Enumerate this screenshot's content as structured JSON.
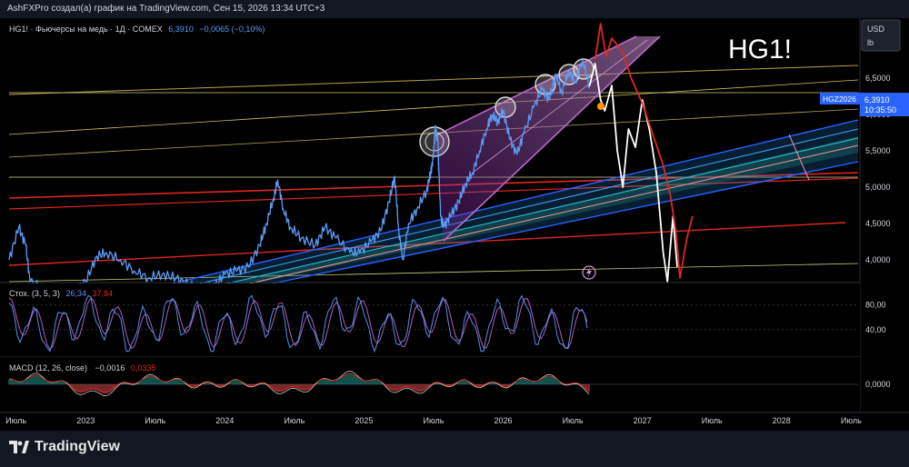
{
  "header": {
    "attribution": "AshFXPro создал(а) график на TradingView.com, Сен 15, 2026 13:34 UTC+3"
  },
  "legend": {
    "symbol": "HG1! · Фьючерсы на медь · 1Д · COMEX",
    "last": "6,3910",
    "change": "−0,0065 (−0,10%)"
  },
  "watermark": "HG1!",
  "currency": {
    "unit": "USD",
    "sub": "lb"
  },
  "price_tag": {
    "contract": "HGZ2026",
    "price": "6,3910",
    "countdown": "10:35:50"
  },
  "stoch": {
    "label": "Стох. (3, 5, 3)",
    "k": "26,34",
    "d": "37,84",
    "ticks": [
      "80,00",
      "40,00"
    ],
    "tick_values": [
      80,
      40
    ],
    "range": [
      0,
      100
    ]
  },
  "macd": {
    "label": "MACD (12, 26, close)",
    "hist": "−0,0016",
    "signal": "0,0335",
    "ticks": [
      "0,0000"
    ]
  },
  "brand": "TradingView",
  "colors": {
    "price": "#5b9cf6",
    "projection_white": "#ffffff",
    "projection_red": "#e0281f",
    "wedge": "#9c27b0",
    "channel": "#2962ff",
    "stoch_k": "#5b8def",
    "stoch_d": "#b45eb8"
  },
  "chart_data": {
    "type": "line",
    "title": "HG1!",
    "y_ticks": [
      "6,5000",
      "6,0000",
      "5,5000",
      "5,0000",
      "4,5000",
      "4,0000"
    ],
    "y_tick_values": [
      6.5,
      6.0,
      5.5,
      5.0,
      4.5,
      4.0
    ],
    "ylim": [
      3.7,
      7.3
    ],
    "x_ticks": [
      "Июль",
      "2023",
      "Июль",
      "2024",
      "Июль",
      "2025",
      "Июль",
      "2026",
      "Июль",
      "2027",
      "Июль",
      "2028",
      "Июль"
    ],
    "x_tick_values": [
      2022.5,
      2023.0,
      2023.5,
      2024.0,
      2024.5,
      2025.0,
      2025.5,
      2026.0,
      2026.5,
      2027.0,
      2027.5,
      2028.0,
      2028.5
    ],
    "xlim": [
      2022.45,
      2028.55
    ],
    "series": [
      {
        "values": [
          [
            2022.45,
            4.0
          ],
          [
            2022.52,
            4.45
          ],
          [
            2022.57,
            4.2
          ],
          [
            2022.6,
            3.7
          ],
          [
            2022.7,
            3.6
          ],
          [
            2022.8,
            3.45
          ],
          [
            2022.9,
            3.55
          ],
          [
            2023.0,
            3.7
          ],
          [
            2023.08,
            4.05
          ],
          [
            2023.15,
            4.1
          ],
          [
            2023.25,
            4.0
          ],
          [
            2023.35,
            3.85
          ],
          [
            2023.45,
            3.75
          ],
          [
            2023.55,
            3.8
          ],
          [
            2023.65,
            3.75
          ],
          [
            2023.75,
            3.65
          ],
          [
            2023.85,
            3.6
          ],
          [
            2023.93,
            3.65
          ],
          [
            2024.0,
            3.8
          ],
          [
            2024.08,
            3.85
          ],
          [
            2024.17,
            3.9
          ],
          [
            2024.25,
            4.2
          ],
          [
            2024.3,
            4.5
          ],
          [
            2024.35,
            4.85
          ],
          [
            2024.38,
            5.1
          ],
          [
            2024.42,
            4.7
          ],
          [
            2024.47,
            4.45
          ],
          [
            2024.55,
            4.3
          ],
          [
            2024.65,
            4.2
          ],
          [
            2024.72,
            4.45
          ],
          [
            2024.8,
            4.3
          ],
          [
            2024.9,
            4.1
          ],
          [
            2024.97,
            4.1
          ],
          [
            2025.05,
            4.25
          ],
          [
            2025.12,
            4.4
          ],
          [
            2025.18,
            4.8
          ],
          [
            2025.22,
            5.15
          ],
          [
            2025.25,
            4.4
          ],
          [
            2025.28,
            4.0
          ],
          [
            2025.32,
            4.5
          ],
          [
            2025.38,
            4.7
          ],
          [
            2025.45,
            4.95
          ],
          [
            2025.48,
            5.2
          ],
          [
            2025.5,
            5.45
          ],
          [
            2025.51,
            5.8
          ],
          [
            2025.53,
            5.65
          ],
          [
            2025.55,
            4.6
          ],
          [
            2025.57,
            4.45
          ],
          [
            2025.62,
            4.6
          ],
          [
            2025.68,
            4.8
          ],
          [
            2025.73,
            5.05
          ],
          [
            2025.78,
            5.2
          ],
          [
            2025.83,
            5.5
          ],
          [
            2025.88,
            5.8
          ],
          [
            2025.92,
            6.0
          ],
          [
            2025.96,
            5.9
          ],
          [
            2026.0,
            6.05
          ],
          [
            2026.05,
            5.65
          ],
          [
            2026.1,
            5.45
          ],
          [
            2026.15,
            5.75
          ],
          [
            2026.22,
            6.1
          ],
          [
            2026.28,
            6.35
          ],
          [
            2026.33,
            6.2
          ],
          [
            2026.38,
            6.55
          ],
          [
            2026.42,
            6.3
          ],
          [
            2026.47,
            6.6
          ],
          [
            2026.52,
            6.45
          ],
          [
            2026.57,
            6.75
          ],
          [
            2026.62,
            6.39
          ]
        ],
        "color": "#5b9cf6"
      },
      {
        "values": [
          [
            2026.62,
            6.39
          ],
          [
            2026.66,
            6.7
          ],
          [
            2026.7,
            6.2
          ],
          [
            2026.73,
            6.05
          ],
          [
            2026.78,
            6.4
          ],
          [
            2026.82,
            5.5
          ],
          [
            2026.86,
            5.0
          ],
          [
            2026.9,
            5.8
          ],
          [
            2026.95,
            5.55
          ],
          [
            2027.0,
            6.2
          ],
          [
            2027.05,
            5.8
          ],
          [
            2027.1,
            5.2
          ],
          [
            2027.15,
            4.1
          ],
          [
            2027.18,
            3.7
          ],
          [
            2027.22,
            4.6
          ],
          [
            2027.25,
            3.9
          ]
        ],
        "color": "#ffffff"
      },
      {
        "values": [
          [
            2026.66,
            6.75
          ],
          [
            2026.7,
            7.25
          ],
          [
            2026.74,
            6.8
          ],
          [
            2026.78,
            7.05
          ],
          [
            2026.82,
            6.95
          ],
          [
            2026.86,
            6.85
          ],
          [
            2026.92,
            6.5
          ],
          [
            2027.0,
            6.15
          ],
          [
            2027.08,
            5.7
          ],
          [
            2027.15,
            5.3
          ],
          [
            2027.2,
            4.9
          ],
          [
            2027.24,
            4.4
          ],
          [
            2027.27,
            3.75
          ],
          [
            2027.32,
            4.3
          ],
          [
            2027.36,
            4.6
          ]
        ],
        "color": "#e0281f"
      }
    ]
  }
}
